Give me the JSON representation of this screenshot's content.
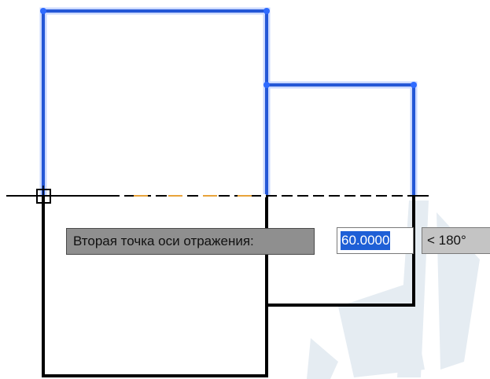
{
  "dynamic_input": {
    "prompt": "Вторая точка оси отражения:",
    "distance_value": "60.0000",
    "angle_value": "< 180°"
  },
  "colors": {
    "selected_geometry": "#2457d6",
    "selection_glow": "#9fb7ff",
    "geometry": "#000000",
    "preview_dash": "#e8a33a",
    "watermark": "#d8e2ec"
  }
}
